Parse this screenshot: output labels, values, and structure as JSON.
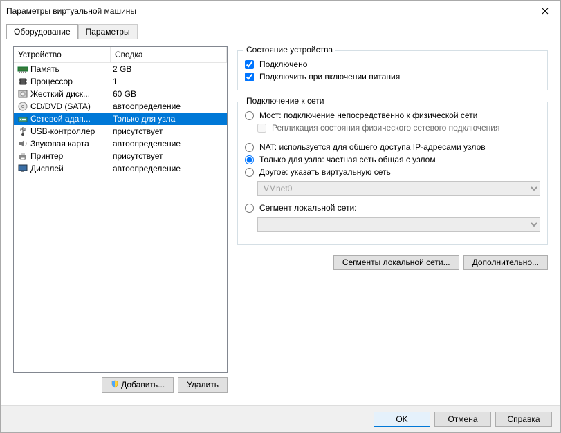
{
  "window": {
    "title": "Параметры виртуальной машины"
  },
  "tabs": {
    "hardware": "Оборудование",
    "options": "Параметры"
  },
  "device_list": {
    "col_device": "Устройство",
    "col_summary": "Сводка",
    "rows": [
      {
        "icon": "memory",
        "name": "Память",
        "summary": "2 GB"
      },
      {
        "icon": "cpu",
        "name": "Процессор",
        "summary": "1"
      },
      {
        "icon": "hdd",
        "name": "Жесткий диск...",
        "summary": "60 GB"
      },
      {
        "icon": "cd",
        "name": "CD/DVD (SATA)",
        "summary": "автоопределение"
      },
      {
        "icon": "net",
        "name": "Сетевой адап...",
        "summary": "Только для узла"
      },
      {
        "icon": "usb",
        "name": "USB-контроллер",
        "summary": "присутствует"
      },
      {
        "icon": "sound",
        "name": "Звуковая карта",
        "summary": "автоопределение"
      },
      {
        "icon": "printer",
        "name": "Принтер",
        "summary": "присутствует"
      },
      {
        "icon": "display",
        "name": "Дисплей",
        "summary": "автоопределение"
      }
    ],
    "selected_index": 4
  },
  "left_buttons": {
    "add": "Добавить...",
    "remove": "Удалить"
  },
  "device_state": {
    "title": "Состояние устройства",
    "connected": "Подключено",
    "connect_power": "Подключить при включении питания"
  },
  "net_conn": {
    "title": "Подключение к сети",
    "bridged": "Мост: подключение непосредственно к физической сети",
    "replicate": "Репликация состояния физического сетевого подключения",
    "nat": "NAT: используется для общего доступа IP-адресами узлов",
    "hostonly": "Только для узла: частная сеть общая с узлом",
    "custom": "Другое: указать виртуальную сеть",
    "custom_value": "VMnet0",
    "lanseg": "Сегмент локальной сети:"
  },
  "right_buttons": {
    "lansegs": "Сегменты локальной сети...",
    "advanced": "Дополнительно..."
  },
  "footer": {
    "ok": "OK",
    "cancel": "Отмена",
    "help": "Справка"
  }
}
